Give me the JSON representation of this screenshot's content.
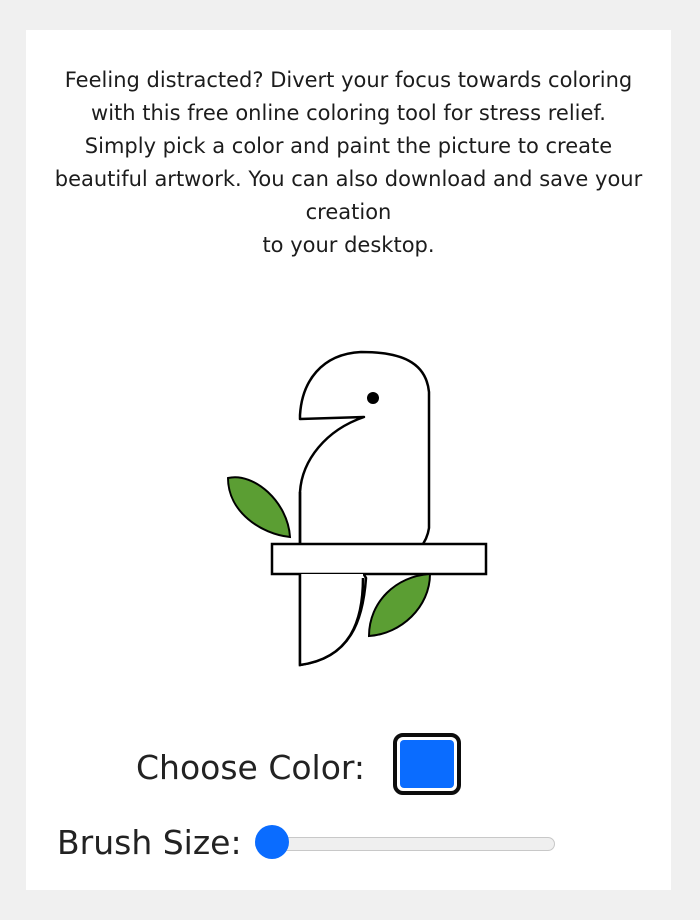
{
  "intro": {
    "lines": [
      "Feeling distracted? Divert your focus towards coloring",
      "with this free online coloring tool for stress relief.",
      "Simply pick a color and paint the picture to create",
      "beautiful artwork. You can also download and save your",
      "creation",
      "to your desktop."
    ]
  },
  "drawing": {
    "subject_icon": "parrot-on-perch-icon",
    "outline_color": "#000000",
    "leaf_color": "#5b9e33",
    "body_color": "#ffffff"
  },
  "controls": {
    "color_label": "Choose Color:",
    "selected_color": "#0a6cff",
    "brush_label": "Brush Size:",
    "brush_value": 0,
    "brush_accent": "#0a6cff"
  }
}
